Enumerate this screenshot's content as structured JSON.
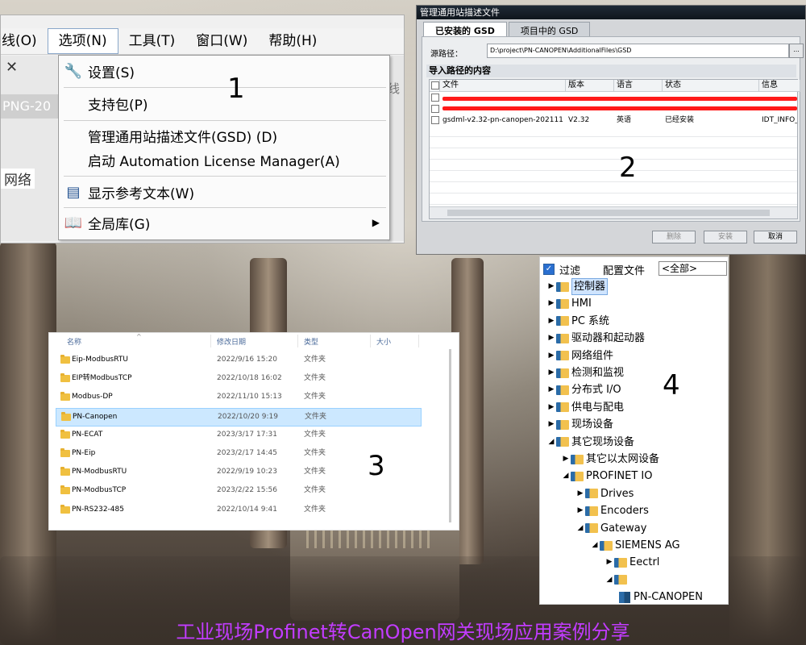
{
  "menu": {
    "menubar": [
      "线(O)",
      "选项(N)",
      "工具(T)",
      "窗口(W)",
      "帮助(H)"
    ],
    "left_fragments": [
      "PNG-20",
      "网络"
    ],
    "right_fragment": "线",
    "items": [
      {
        "label": "设置(S)",
        "icon": "wrench-icon"
      },
      {
        "label": "支持包(P)",
        "icon": ""
      },
      {
        "label": "管理通用站描述文件(GSD) (D)",
        "icon": ""
      },
      {
        "label": "启动 Automation License Manager(A)",
        "icon": ""
      },
      {
        "label": "显示参考文本(W)",
        "icon": "reference-text-icon"
      },
      {
        "label": "全局库(G)",
        "icon": "book-icon"
      }
    ]
  },
  "gsd_dialog": {
    "title": "管理通用站描述文件",
    "tabs": [
      "已安装的 GSD",
      "项目中的 GSD"
    ],
    "source_label": "源路径：",
    "source_path": "D:\\project\\PN-CANOPEN\\AdditionalFiles\\GSD",
    "browse": "...",
    "section": "导入路径的内容",
    "columns": [
      "文件",
      "版本",
      "语言",
      "状态",
      "信息"
    ],
    "rows": [
      {
        "file": "gsdml-v2.32-pn-canopen-202111...",
        "version": "V2.32",
        "language": "英语",
        "status": "已经安装",
        "info": "IDT_INFO_..."
      }
    ],
    "buttons": [
      "删除",
      "安装",
      "取消"
    ]
  },
  "explorer": {
    "columns": [
      "名称",
      "修改日期",
      "类型",
      "大小"
    ],
    "rows": [
      {
        "name": "Eip-ModbusRTU",
        "date": "2022/9/16 15:20",
        "type": "文件夹",
        "selected": false
      },
      {
        "name": "EIP转ModbusTCP",
        "date": "2022/10/18 16:02",
        "type": "文件夹",
        "selected": false
      },
      {
        "name": "Modbus-DP",
        "date": "2022/11/10 15:13",
        "type": "文件夹",
        "selected": false
      },
      {
        "name": "PN-Canopen",
        "date": "2022/10/20 9:19",
        "type": "文件夹",
        "selected": true
      },
      {
        "name": "PN-ECAT",
        "date": "2023/3/17 17:31",
        "type": "文件夹",
        "selected": false
      },
      {
        "name": "PN-Eip",
        "date": "2023/2/17 14:45",
        "type": "文件夹",
        "selected": false
      },
      {
        "name": "PN-ModbusRTU",
        "date": "2022/9/19 10:23",
        "type": "文件夹",
        "selected": false
      },
      {
        "name": "PN-ModbusTCP",
        "date": "2023/2/22 15:56",
        "type": "文件夹",
        "selected": false
      },
      {
        "name": "PN-RS232-485",
        "date": "2022/10/14 9:41",
        "type": "文件夹",
        "selected": false
      }
    ]
  },
  "catalog": {
    "filter_label": "过滤",
    "profile_label": "配置文件",
    "profile_value": "<全部>",
    "nodes": [
      {
        "label": "控制器",
        "level": 0,
        "expanded": false,
        "highlight": true
      },
      {
        "label": "HMI",
        "level": 0,
        "expanded": false
      },
      {
        "label": "PC 系统",
        "level": 0,
        "expanded": false
      },
      {
        "label": "驱动器和起动器",
        "level": 0,
        "expanded": false
      },
      {
        "label": "网络组件",
        "level": 0,
        "expanded": false
      },
      {
        "label": "检测和监视",
        "level": 0,
        "expanded": false
      },
      {
        "label": "分布式 I/O",
        "level": 0,
        "expanded": false
      },
      {
        "label": "供电与配电",
        "level": 0,
        "expanded": false
      },
      {
        "label": "现场设备",
        "level": 0,
        "expanded": false
      },
      {
        "label": "其它现场设备",
        "level": 0,
        "expanded": true
      },
      {
        "label": "其它以太网设备",
        "level": 1,
        "expanded": false
      },
      {
        "label": "PROFINET IO",
        "level": 1,
        "expanded": true
      },
      {
        "label": "Drives",
        "level": 2,
        "expanded": false
      },
      {
        "label": "Encoders",
        "level": 2,
        "expanded": false
      },
      {
        "label": "Gateway",
        "level": 2,
        "expanded": true
      },
      {
        "label": "SIEMENS AG",
        "level": 3,
        "expanded": true
      },
      {
        "label": "Eectrl",
        "level": 4,
        "expanded": false
      },
      {
        "label": "",
        "level": 4,
        "expanded": true
      },
      {
        "label": "PN-CANOPEN",
        "level": 5,
        "device": true
      }
    ]
  },
  "labels": [
    "1",
    "2",
    "3",
    "4"
  ],
  "caption": "工业现场Profinet转CanOpen网关现场应用案例分享",
  "colors": {
    "caption": "#c23cff",
    "selection": "#cce8ff",
    "dialog_title": "#0f151c",
    "red_redaction": "#ff1a1a"
  }
}
